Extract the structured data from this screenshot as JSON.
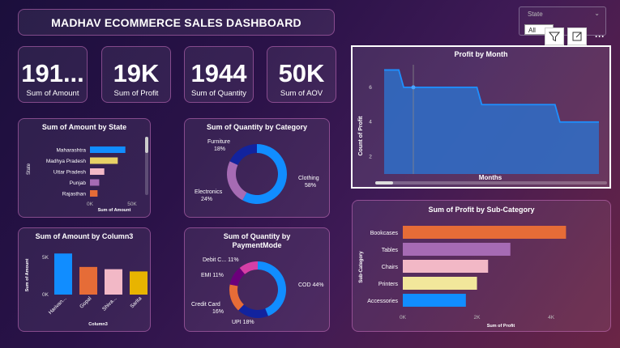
{
  "header": {
    "title": "MADHAV ECOMMERCE SALES DASHBOARD"
  },
  "kpis": [
    {
      "value": "191...",
      "label": "Sum of Amount"
    },
    {
      "value": "19K",
      "label": "Sum of Profit"
    },
    {
      "value": "1944",
      "label": "Sum of Quantity"
    },
    {
      "value": "50K",
      "label": "Sum of AOV"
    }
  ],
  "slicer": {
    "label": "State",
    "value": "All"
  },
  "toolbar": {
    "filter_icon": "filter-icon",
    "focus_icon": "focus-mode-icon",
    "more_icon": "more-options-icon",
    "more_label": "···"
  },
  "colors": {
    "accent_blue": "#118DFF",
    "orange": "#E66C37",
    "purple": "#A66BB4",
    "pink": "#F2B8C6",
    "yellow": "#E8D166",
    "navy": "#12239E",
    "magenta": "#D63FA6"
  },
  "chart_data": [
    {
      "id": "amount_by_state",
      "type": "bar",
      "orientation": "horizontal",
      "title": "Sum of Amount by State",
      "xlabel": "Sum of Amount",
      "ylabel": "State",
      "categories": [
        "Maharashtra",
        "Madhya Pradesh",
        "Uttar Pradesh",
        "Punjab",
        "Rajasthan"
      ],
      "values": [
        42000,
        33000,
        17000,
        11000,
        9000
      ],
      "colors": [
        "#118DFF",
        "#E8D166",
        "#F2B8C6",
        "#A66BB4",
        "#E66C37"
      ],
      "xticks": [
        "0K",
        "50K"
      ],
      "xlim": [
        0,
        50000
      ]
    },
    {
      "id": "quantity_by_category",
      "type": "pie",
      "donut": true,
      "title": "Sum of Quantity by Category",
      "categories": [
        "Clothing",
        "Electronics",
        "Furniture"
      ],
      "values": [
        58,
        24,
        18
      ],
      "labels": [
        "Clothing\n58%",
        "Electronics\n24%",
        "Furniture\n18%"
      ],
      "colors": [
        "#118DFF",
        "#A66BB4",
        "#12239E"
      ]
    },
    {
      "id": "profit_by_month",
      "type": "line",
      "title": "Profit by Month",
      "xlabel": "Months",
      "ylabel": "Count of Profit",
      "yticks": [
        2,
        4,
        6
      ],
      "ylim": [
        1,
        7.3
      ],
      "x": [
        1,
        2,
        3,
        4,
        5,
        6,
        7,
        8,
        9,
        10,
        11,
        12
      ],
      "values": [
        7,
        6,
        6,
        6,
        6,
        5,
        5,
        5,
        5,
        4,
        4,
        4
      ]
    },
    {
      "id": "amount_by_column3",
      "type": "bar",
      "title": "Sum of Amount by Column3",
      "xlabel": "Column3",
      "ylabel": "Sum of Amount",
      "categories": [
        "Harivan...",
        "Gopal",
        "Shiva...",
        "Sarita"
      ],
      "values": [
        5500,
        3700,
        3400,
        3100
      ],
      "colors": [
        "#118DFF",
        "#E66C37",
        "#F2B8C6",
        "#E8B400"
      ],
      "yticks": [
        "0K",
        "5K"
      ],
      "ylim": [
        0,
        6500
      ]
    },
    {
      "id": "quantity_by_paymentmode",
      "type": "pie",
      "donut": true,
      "title": "Sum of Quantity by PaymentMode",
      "categories": [
        "COD",
        "UPI",
        "Credit Card",
        "EMI",
        "Debit C..."
      ],
      "values": [
        44,
        18,
        16,
        11,
        11
      ],
      "labels": [
        "COD 44%",
        "UPI 18%",
        "Credit Card\n16%",
        "EMI 11%",
        "Debit C... 11%"
      ],
      "colors": [
        "#118DFF",
        "#12239E",
        "#E66C37",
        "#6B007B",
        "#D63FA6"
      ]
    },
    {
      "id": "profit_by_subcategory",
      "type": "bar",
      "orientation": "horizontal",
      "title": "Sum of Profit by Sub-Category",
      "xlabel": "Sum of Profit",
      "ylabel": "Sub-Category",
      "categories": [
        "Bookcases",
        "Tables",
        "Chairs",
        "Printers",
        "Accessories"
      ],
      "values": [
        4400,
        2900,
        2300,
        2000,
        1700
      ],
      "colors": [
        "#E66C37",
        "#A66BB4",
        "#F2B8C6",
        "#F2E79B",
        "#118DFF"
      ],
      "xticks": [
        "0K",
        "2K",
        "4K"
      ],
      "xlim": [
        0,
        5200
      ]
    }
  ]
}
